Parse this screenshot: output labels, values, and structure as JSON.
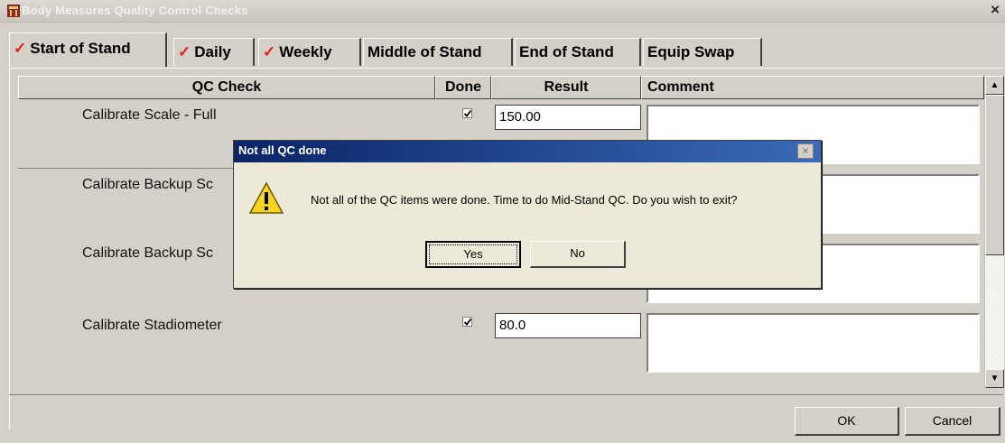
{
  "window": {
    "title": "Body Measures Quality Control Checks",
    "close_label": "×"
  },
  "tabs": [
    {
      "label": "Start of Stand",
      "checked": true,
      "active": true
    },
    {
      "label": "Daily",
      "checked": true
    },
    {
      "label": "Weekly",
      "checked": true
    },
    {
      "label": "Middle of Stand"
    },
    {
      "label": "End of Stand"
    },
    {
      "label": "Equip Swap"
    }
  ],
  "check_glyph": "✓",
  "table": {
    "columns": [
      "QC Check",
      "Done",
      "Result",
      "Comment"
    ],
    "rows": [
      {
        "check": "Calibrate Scale - Full",
        "done": true,
        "result": "150.00",
        "comment": ""
      },
      {
        "check": "Calibrate Backup Sc",
        "done": false,
        "result": "",
        "comment": ""
      },
      {
        "check": "Calibrate Backup Sc",
        "done": false,
        "result": "",
        "comment": ""
      },
      {
        "check": "Calibrate Stadiometer",
        "done": true,
        "result": "80.0",
        "comment": ""
      }
    ]
  },
  "scrollbar": {
    "up": "▲",
    "down": "▼"
  },
  "footer": {
    "ok_label": "OK",
    "cancel_label": "Cancel"
  },
  "dialog": {
    "title": "Not all QC done",
    "close_label": "×",
    "message": "Not all of the QC items were done. Time to do Mid-Stand QC. Do you wish to exit?",
    "yes_label": "Yes",
    "no_label": "No",
    "icon": "warning-icon"
  },
  "colors": {
    "check_red": "#e0201c",
    "dialog_title": "#0a2466",
    "warning_yellow": "#f7d51c"
  }
}
